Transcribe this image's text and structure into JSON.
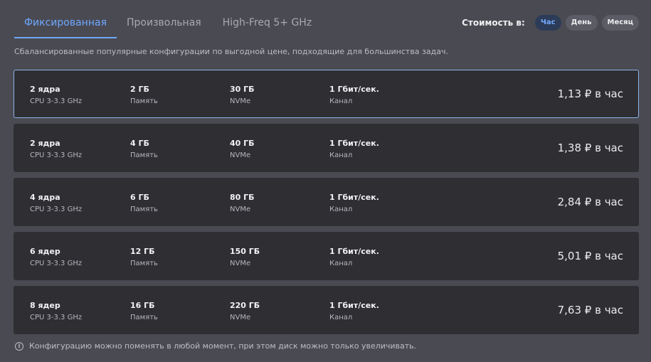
{
  "tabs": [
    {
      "label": "Фиксированная",
      "active": true
    },
    {
      "label": "Произвольная",
      "active": false
    },
    {
      "label": "High-Freq 5+ GHz",
      "active": false
    }
  ],
  "period": {
    "label": "Стоимость в:",
    "options": [
      {
        "label": "Час",
        "active": true
      },
      {
        "label": "День",
        "active": false
      },
      {
        "label": "Месяц",
        "active": false
      }
    ]
  },
  "subtitle": "Сбалансированные популярные конфигурации по выгодной цене, подходящие для большинства задач.",
  "columns": {
    "cpu_label": "CPU 3-3.3 GHz",
    "ram_label": "Память",
    "disk_label": "NVMe",
    "net_label": "Канал"
  },
  "configs": [
    {
      "cpu": "2 ядра",
      "ram": "2 ГБ",
      "disk": "30 ГБ",
      "net": "1 Гбит/сек.",
      "price": "1,13 ₽ в час",
      "selected": true
    },
    {
      "cpu": "2 ядра",
      "ram": "4 ГБ",
      "disk": "40 ГБ",
      "net": "1 Гбит/сек.",
      "price": "1,38 ₽ в час",
      "selected": false
    },
    {
      "cpu": "4 ядра",
      "ram": "6 ГБ",
      "disk": "80 ГБ",
      "net": "1 Гбит/сек.",
      "price": "2,84 ₽ в час",
      "selected": false
    },
    {
      "cpu": "6 ядер",
      "ram": "12 ГБ",
      "disk": "150 ГБ",
      "net": "1 Гбит/сек.",
      "price": "5,01 ₽ в час",
      "selected": false
    },
    {
      "cpu": "8 ядер",
      "ram": "16 ГБ",
      "disk": "220 ГБ",
      "net": "1 Гбит/сек.",
      "price": "7,63 ₽ в час",
      "selected": false
    }
  ],
  "footnote": {
    "icon": "info-icon",
    "text": "Конфигурацию можно поменять в любой момент, при этом диск можно только увеличивать."
  },
  "colors": {
    "accent": "#6ea8ff",
    "background": "#4a4a52",
    "row": "#2e2e33"
  }
}
